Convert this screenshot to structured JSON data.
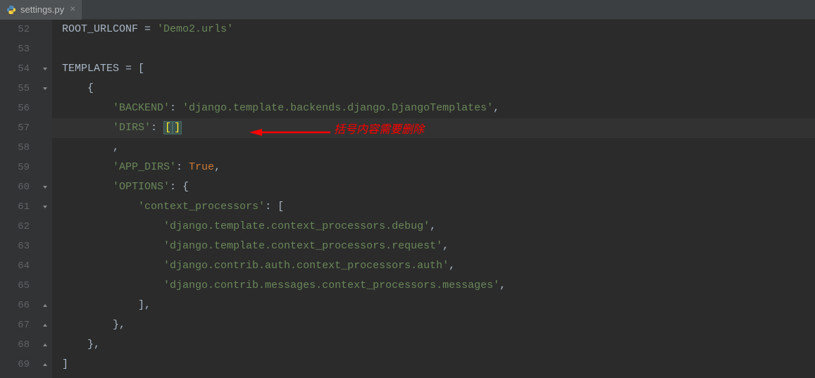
{
  "tab": {
    "filename": "settings.py",
    "close_symbol": "×"
  },
  "annotation": {
    "text": "括号内容需要删除"
  },
  "lines": [
    {
      "num": "52",
      "indent": 0,
      "tokens": [
        {
          "t": "var",
          "v": "ROOT_URLCONF "
        },
        {
          "t": "op",
          "v": "= "
        },
        {
          "t": "str",
          "v": "'Demo2.urls'"
        }
      ]
    },
    {
      "num": "53",
      "indent": 0,
      "tokens": []
    },
    {
      "num": "54",
      "indent": 0,
      "tokens": [
        {
          "t": "var",
          "v": "TEMPLATES "
        },
        {
          "t": "op",
          "v": "= "
        },
        {
          "t": "brace",
          "v": "["
        }
      ]
    },
    {
      "num": "55",
      "indent": 1,
      "tokens": [
        {
          "t": "brace",
          "v": "{"
        }
      ]
    },
    {
      "num": "56",
      "indent": 2,
      "tokens": [
        {
          "t": "str",
          "v": "'BACKEND'"
        },
        {
          "t": "op",
          "v": ": "
        },
        {
          "t": "str",
          "v": "'django.template.backends.django.DjangoTemplates'"
        },
        {
          "t": "op",
          "v": ","
        }
      ]
    },
    {
      "num": "57",
      "indent": 2,
      "highlighted": true,
      "tokens": [
        {
          "t": "str",
          "v": "'DIRS'"
        },
        {
          "t": "op",
          "v": ": "
        },
        {
          "t": "match",
          "v": "["
        },
        {
          "t": "match",
          "v": "]"
        }
      ],
      "annotation": true
    },
    {
      "num": "58",
      "indent": 2,
      "tokens": [
        {
          "t": "op",
          "v": ","
        }
      ]
    },
    {
      "num": "59",
      "indent": 2,
      "tokens": [
        {
          "t": "str",
          "v": "'APP_DIRS'"
        },
        {
          "t": "op",
          "v": ": "
        },
        {
          "t": "key",
          "v": "True"
        },
        {
          "t": "op",
          "v": ","
        }
      ]
    },
    {
      "num": "60",
      "indent": 2,
      "tokens": [
        {
          "t": "str",
          "v": "'OPTIONS'"
        },
        {
          "t": "op",
          "v": ": "
        },
        {
          "t": "brace",
          "v": "{"
        }
      ]
    },
    {
      "num": "61",
      "indent": 3,
      "tokens": [
        {
          "t": "str",
          "v": "'context_processors'"
        },
        {
          "t": "op",
          "v": ": "
        },
        {
          "t": "brace",
          "v": "["
        }
      ]
    },
    {
      "num": "62",
      "indent": 4,
      "tokens": [
        {
          "t": "str",
          "v": "'django.template.context_processors.debug'"
        },
        {
          "t": "op",
          "v": ","
        }
      ]
    },
    {
      "num": "63",
      "indent": 4,
      "tokens": [
        {
          "t": "str",
          "v": "'django.template.context_processors.request'"
        },
        {
          "t": "op",
          "v": ","
        }
      ]
    },
    {
      "num": "64",
      "indent": 4,
      "tokens": [
        {
          "t": "str",
          "v": "'django.contrib.auth.context_processors.auth'"
        },
        {
          "t": "op",
          "v": ","
        }
      ]
    },
    {
      "num": "65",
      "indent": 4,
      "tokens": [
        {
          "t": "str",
          "v": "'django.contrib.messages.context_processors.messages'"
        },
        {
          "t": "op",
          "v": ","
        }
      ]
    },
    {
      "num": "66",
      "indent": 3,
      "tokens": [
        {
          "t": "brace",
          "v": "]"
        },
        {
          "t": "op",
          "v": ","
        }
      ]
    },
    {
      "num": "67",
      "indent": 2,
      "tokens": [
        {
          "t": "brace",
          "v": "}"
        },
        {
          "t": "op",
          "v": ","
        }
      ]
    },
    {
      "num": "68",
      "indent": 1,
      "tokens": [
        {
          "t": "brace",
          "v": "}"
        },
        {
          "t": "op",
          "v": ","
        }
      ]
    },
    {
      "num": "69",
      "indent": 0,
      "tokens": [
        {
          "t": "brace",
          "v": "]"
        }
      ]
    }
  ],
  "fold_markers": [
    {
      "line_index": 2,
      "type": "open"
    },
    {
      "line_index": 3,
      "type": "open"
    },
    {
      "line_index": 8,
      "type": "open"
    },
    {
      "line_index": 9,
      "type": "open"
    },
    {
      "line_index": 14,
      "type": "close"
    },
    {
      "line_index": 15,
      "type": "close"
    },
    {
      "line_index": 16,
      "type": "close"
    },
    {
      "line_index": 17,
      "type": "close"
    }
  ]
}
